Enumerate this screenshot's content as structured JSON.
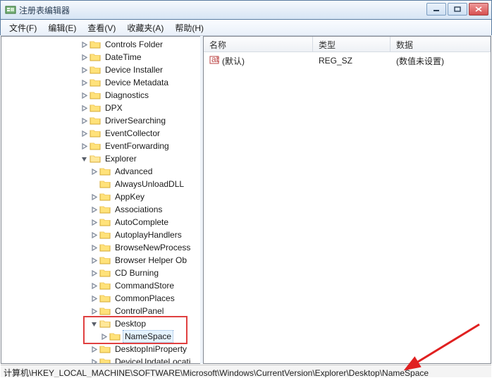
{
  "window": {
    "title": "注册表编辑器"
  },
  "menu": {
    "file": "文件(F)",
    "edit": "编辑(E)",
    "view": "查看(V)",
    "favorites": "收藏夹(A)",
    "help": "帮助(H)"
  },
  "columns": {
    "name": "名称",
    "type": "类型",
    "data": "数据"
  },
  "rows": [
    {
      "icon": "string-value-icon",
      "name": "(默认)",
      "type": "REG_SZ",
      "data": "(数值未设置)"
    }
  ],
  "tree": [
    {
      "depth": 8,
      "exp": "closed",
      "label": "Controls Folder"
    },
    {
      "depth": 8,
      "exp": "closed",
      "label": "DateTime"
    },
    {
      "depth": 8,
      "exp": "closed",
      "label": "Device Installer"
    },
    {
      "depth": 8,
      "exp": "closed",
      "label": "Device Metadata"
    },
    {
      "depth": 8,
      "exp": "closed",
      "label": "Diagnostics"
    },
    {
      "depth": 8,
      "exp": "closed",
      "label": "DPX"
    },
    {
      "depth": 8,
      "exp": "closed",
      "label": "DriverSearching"
    },
    {
      "depth": 8,
      "exp": "closed",
      "label": "EventCollector"
    },
    {
      "depth": 8,
      "exp": "closed",
      "label": "EventForwarding"
    },
    {
      "depth": 8,
      "exp": "open",
      "label": "Explorer"
    },
    {
      "depth": 9,
      "exp": "closed",
      "label": "Advanced"
    },
    {
      "depth": 9,
      "exp": "none",
      "label": "AlwaysUnloadDLL"
    },
    {
      "depth": 9,
      "exp": "closed",
      "label": "AppKey"
    },
    {
      "depth": 9,
      "exp": "closed",
      "label": "Associations"
    },
    {
      "depth": 9,
      "exp": "closed",
      "label": "AutoComplete"
    },
    {
      "depth": 9,
      "exp": "closed",
      "label": "AutoplayHandlers"
    },
    {
      "depth": 9,
      "exp": "closed",
      "label": "BrowseNewProcess"
    },
    {
      "depth": 9,
      "exp": "closed",
      "label": "Browser Helper Ob"
    },
    {
      "depth": 9,
      "exp": "closed",
      "label": "CD Burning"
    },
    {
      "depth": 9,
      "exp": "closed",
      "label": "CommandStore"
    },
    {
      "depth": 9,
      "exp": "closed",
      "label": "CommonPlaces"
    },
    {
      "depth": 9,
      "exp": "closed",
      "label": "ControlPanel"
    },
    {
      "depth": 9,
      "exp": "open",
      "label": "Desktop"
    },
    {
      "depth": 10,
      "exp": "closed",
      "label": "NameSpace",
      "selected": true
    },
    {
      "depth": 9,
      "exp": "closed",
      "label": "DesktopIniProperty"
    },
    {
      "depth": 9,
      "exp": "closed",
      "label": "DeviceUpdateLocati"
    }
  ],
  "highlight": {
    "top_index": 22,
    "rows": 2
  },
  "status": "计算机\\HKEY_LOCAL_MACHINE\\SOFTWARE\\Microsoft\\Windows\\CurrentVersion\\Explorer\\Desktop\\NameSpace"
}
